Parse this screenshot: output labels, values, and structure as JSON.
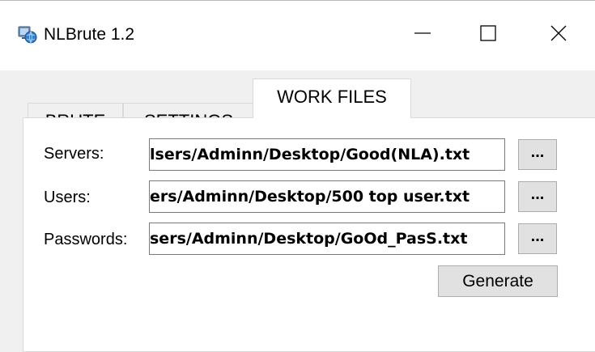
{
  "window": {
    "title": "NLBrute 1.2",
    "icon": "app-icon",
    "controls": {
      "minimize": "minimize-icon",
      "maximize": "maximize-icon",
      "close": "close-icon"
    }
  },
  "tabs": [
    {
      "label": "BRUTE",
      "active": false
    },
    {
      "label": "SETTINGS",
      "active": false
    },
    {
      "label": "WORK FILES",
      "active": true
    }
  ],
  "work_files": {
    "servers_label": "Servers:",
    "servers_value": "lsers/Adminn/Desktop/Good(NLA).txt",
    "users_label": "Users:",
    "users_value": "ers/Adminn/Desktop/500 top user.txt",
    "passwords_label": "Passwords:",
    "passwords_value": "sers/Adminn/Desktop/GoOd_PasS.txt",
    "browse_label": "...",
    "generate_label": "Generate"
  }
}
